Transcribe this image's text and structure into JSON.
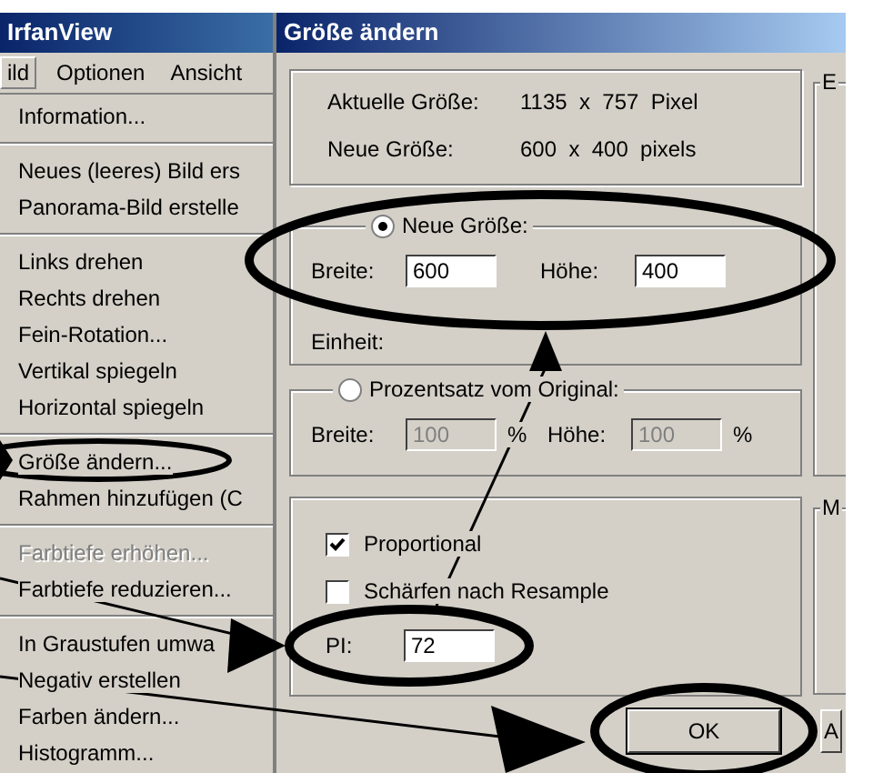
{
  "app_window": {
    "title": "IrfanView",
    "menu_bar": [
      {
        "label": "ild",
        "selected": true
      },
      {
        "label": "Optionen",
        "selected": false
      },
      {
        "label": "Ansicht",
        "selected": false
      }
    ],
    "menu_items": [
      {
        "kind": "item",
        "label": "Information...",
        "disabled": false
      },
      {
        "kind": "separator"
      },
      {
        "kind": "item",
        "label": "Neues (leeres) Bild ers",
        "disabled": false
      },
      {
        "kind": "item",
        "label": "Panorama-Bild erstelle",
        "disabled": false
      },
      {
        "kind": "separator"
      },
      {
        "kind": "item",
        "label": "Links drehen",
        "disabled": false
      },
      {
        "kind": "item",
        "label": "Rechts drehen",
        "disabled": false
      },
      {
        "kind": "item",
        "label": "Fein-Rotation...",
        "disabled": false
      },
      {
        "kind": "item",
        "label": "Vertikal spiegeln",
        "disabled": false
      },
      {
        "kind": "item",
        "label": "Horizontal spiegeln",
        "disabled": false
      },
      {
        "kind": "separator"
      },
      {
        "kind": "item",
        "label": "Größe ändern...",
        "disabled": false
      },
      {
        "kind": "item",
        "label": "Rahmen hinzufügen (C",
        "disabled": false
      },
      {
        "kind": "separator"
      },
      {
        "kind": "item",
        "label": "Farbtiefe erhöhen...",
        "disabled": true
      },
      {
        "kind": "item",
        "label": "Farbtiefe reduzieren...",
        "disabled": false
      },
      {
        "kind": "separator"
      },
      {
        "kind": "item",
        "label": "In Graustufen umwa",
        "disabled": false
      },
      {
        "kind": "item",
        "label": "Negativ erstellen",
        "disabled": false
      },
      {
        "kind": "item",
        "label": "Farben ändern...",
        "disabled": false
      },
      {
        "kind": "item",
        "label": "Histogramm...",
        "disabled": false
      }
    ]
  },
  "dialog": {
    "title": "Größe ändern",
    "info": [
      {
        "label": "Aktuelle Größe:",
        "value": "1135  x  757  Pixel"
      },
      {
        "label": "Neue Größe:",
        "value": "600  x  400  pixels"
      }
    ],
    "new_size_group": {
      "legend": "Neue Größe:",
      "selected": true,
      "width_label": "Breite:",
      "width_value": "600",
      "height_label": "Höhe:",
      "height_value": "400",
      "unit_label": "Einheit:"
    },
    "percent_group": {
      "legend": "Prozentsatz vom Original:",
      "selected": false,
      "disabled": true,
      "width_label": "Breite:",
      "width_value": "100",
      "width_unit": "%",
      "height_label": "Höhe:",
      "height_value": "100",
      "height_unit": "%"
    },
    "options": [
      {
        "label": "Proportional",
        "checked": true
      },
      {
        "label": "Schärfen nach Resample",
        "checked": false
      }
    ],
    "dpi": {
      "label": "PI:",
      "value": "72"
    },
    "right_groups": [
      {
        "legend": "E"
      },
      {
        "legend": "M"
      }
    ],
    "buttons": [
      {
        "label": "OK",
        "default": true
      },
      {
        "label": "A",
        "default": false
      }
    ]
  }
}
